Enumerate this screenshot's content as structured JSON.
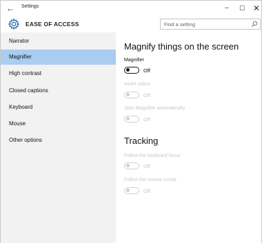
{
  "window": {
    "title": "Settings",
    "back_glyph": "←",
    "minimize_glyph": "–",
    "maximize_glyph": "☐",
    "close_glyph": "✕"
  },
  "header": {
    "title": "EASE OF ACCESS",
    "icon": "gear-icon"
  },
  "search": {
    "placeholder": "Find a setting",
    "value": ""
  },
  "sidebar": {
    "items": [
      {
        "label": "Narrator",
        "active": false
      },
      {
        "label": "Magnifier",
        "active": true
      },
      {
        "label": "High contrast",
        "active": false
      },
      {
        "label": "Closed captions",
        "active": false
      },
      {
        "label": "Keyboard",
        "active": false
      },
      {
        "label": "Mouse",
        "active": false
      },
      {
        "label": "Other options",
        "active": false
      }
    ]
  },
  "main": {
    "heading": "Magnify things on the screen",
    "magnifier": {
      "label": "Magnifier",
      "state": "Off",
      "enabled": true,
      "on": false
    },
    "invert_colors": {
      "label": "Invert colors",
      "state": "Off",
      "enabled": false,
      "on": false
    },
    "start_auto": {
      "label": "Start Magnifier automatically",
      "state": "Off",
      "enabled": false,
      "on": false
    },
    "tracking_heading": "Tracking",
    "follow_keyboard": {
      "label": "Follow the keyboard focus",
      "state": "Off",
      "enabled": false,
      "on": false
    },
    "follow_mouse": {
      "label": "Follow the mouse cursor",
      "state": "Off",
      "enabled": false,
      "on": false
    }
  },
  "colors": {
    "active_nav": "#a9cdf0",
    "sidebar_bg": "#f2f2f2",
    "disabled_text": "#c8c8c8"
  }
}
